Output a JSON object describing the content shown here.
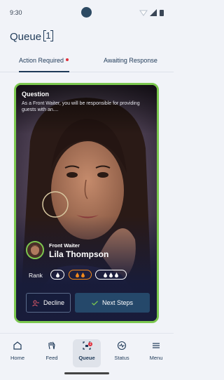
{
  "status": {
    "time": "9:30"
  },
  "header": {
    "title": "Queue",
    "count": "1"
  },
  "tabs": [
    {
      "label": "Action Required",
      "active": true,
      "has_dot": true
    },
    {
      "label": "Awaiting Response",
      "active": false
    }
  ],
  "card": {
    "question_label": "Question",
    "question_text": "As a Front Waiter, you will be responsible for providing guests with an....",
    "role": "Front Waiter",
    "name": "Lila Thompson",
    "rank_label": "Rank",
    "decline_label": "Decline",
    "next_label": "Next Steps",
    "accent_color": "#7cc84f"
  },
  "nav": {
    "items": [
      {
        "label": "Home",
        "icon": "home-icon"
      },
      {
        "label": "Feed",
        "icon": "hand-icon"
      },
      {
        "label": "Queue",
        "icon": "queue-icon",
        "active": true,
        "badge": "1"
      },
      {
        "label": "Status",
        "icon": "status-icon"
      },
      {
        "label": "Menu",
        "icon": "menu-icon"
      }
    ]
  }
}
